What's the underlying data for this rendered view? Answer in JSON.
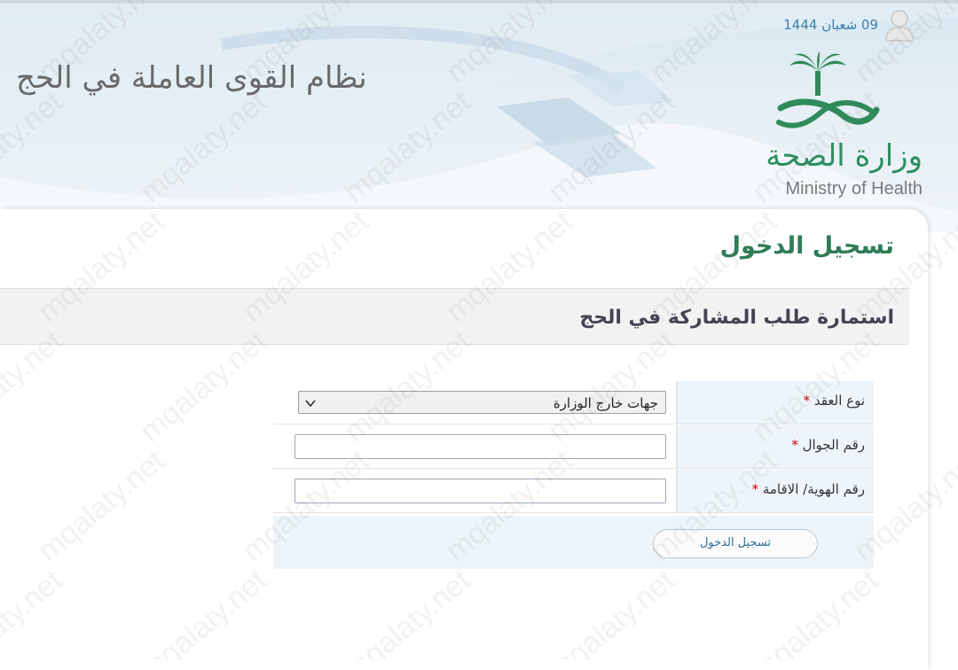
{
  "header": {
    "system_title": "نظام القوى العاملة في الحج",
    "hijri_date": "09 شعبان 1444",
    "logo": {
      "name_ar": "وزارة الصحة",
      "name_en": "Ministry of Health"
    }
  },
  "page": {
    "heading": "تسجيل الدخول",
    "section_title": "استمارة طلب المشاركة في الحج"
  },
  "form": {
    "contract_type": {
      "label": "نوع العقد",
      "required_mark": "*",
      "value": "جهات خارج الوزارة"
    },
    "mobile": {
      "label": "رقم الجوال",
      "required_mark": "*",
      "value": ""
    },
    "id_number": {
      "label": "رقم الهوية/ الاقامة",
      "required_mark": "*",
      "value": ""
    },
    "submit_label": "تسجيل الدخول"
  },
  "watermark": {
    "text": "mqalaty.net"
  },
  "colors": {
    "heading_green": "#2f7d57",
    "required_red": "#d40000",
    "link_blue": "#3a7fae",
    "label_cell_bg": "#eef5fa"
  },
  "icons": {
    "user": "user-avatar-icon",
    "select": "chevron-down-icon"
  }
}
